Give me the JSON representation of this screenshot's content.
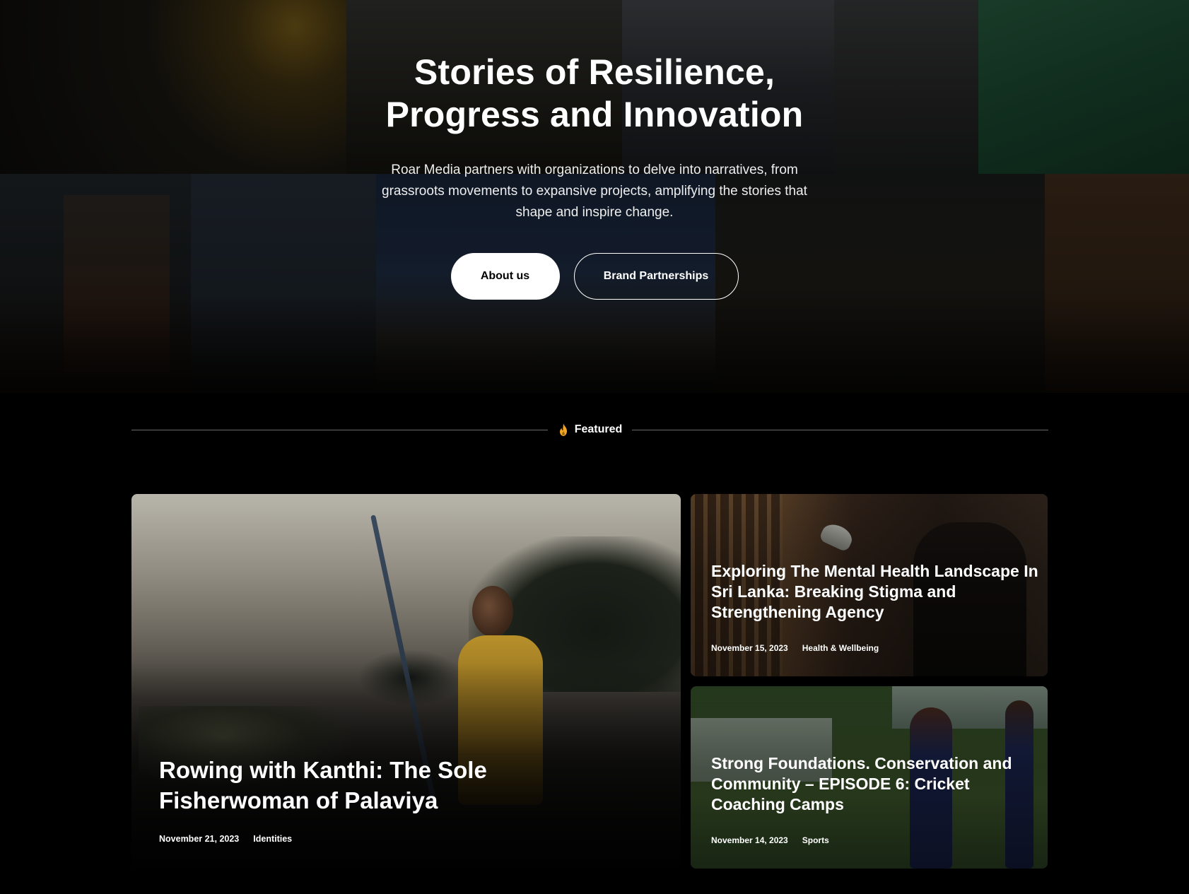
{
  "hero": {
    "title_line1": "Stories of Resilience,",
    "title_line2": "Progress and Innovation",
    "description": "Roar Media partners with organizations to delve into narratives, from grassroots movements to expansive projects, amplifying the stories that shape and inspire change.",
    "buttons": {
      "about": "About us",
      "partnerships": "Brand Partnerships"
    }
  },
  "featured": {
    "label": "Featured",
    "icon": "flame-icon",
    "accent_color": "#f5a623"
  },
  "articles": [
    {
      "title": "Rowing with Kanthi: The Sole Fisherwoman of Palaviya",
      "date": "November 21, 2023",
      "category": "Identities"
    },
    {
      "title": "Exploring The Mental Health Landscape In Sri Lanka: Breaking Stigma and Strengthening Agency",
      "date": "November 15, 2023",
      "category": "Health & Wellbeing"
    },
    {
      "title": "Strong Foundations. Conservation and Community – EPISODE 6: Cricket Coaching Camps",
      "date": "November 14, 2023",
      "category": "Sports"
    }
  ]
}
